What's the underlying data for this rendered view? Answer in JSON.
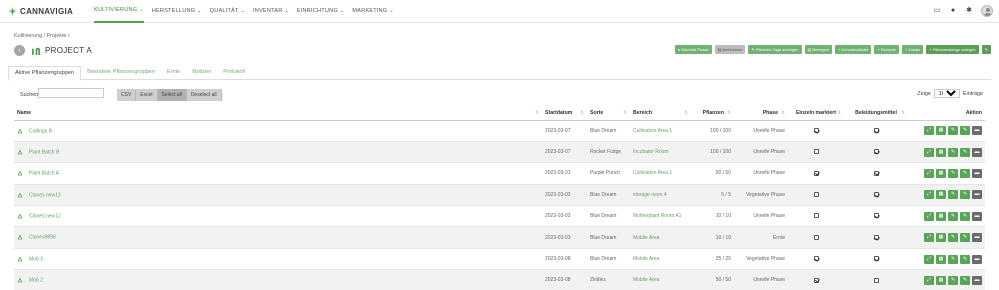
{
  "app": {
    "logo_text": "CANNAVIGIA"
  },
  "nav": [
    {
      "label": "KULTIVIERUNG",
      "active": true,
      "caret": true
    },
    {
      "label": "HERSTELLUNG",
      "active": false,
      "caret": true
    },
    {
      "label": "QUALITÄT",
      "active": false,
      "caret": true
    },
    {
      "label": "INVENTAR",
      "active": false,
      "caret": true
    },
    {
      "label": "EINRICHTUNG",
      "active": false,
      "caret": true
    },
    {
      "label": "MARKETING",
      "active": false,
      "caret": true
    }
  ],
  "breadcrumb": "Kultivierung / Projekte /",
  "title": "PROJECT A",
  "actions": [
    {
      "label": "▸ Nächste Phase",
      "style": "green"
    },
    {
      "label": "▤ Archivieren",
      "style": "gray"
    },
    {
      "label": "✎ Pflanzen-Tags anzeigen",
      "style": "green"
    },
    {
      "label": "▤ Bewegen",
      "style": "green"
    },
    {
      "label": "+ Kreuzbestäube",
      "style": "green"
    },
    {
      "label": "+ Rezepte",
      "style": "green"
    },
    {
      "label": "+ Zusatz",
      "style": "green"
    },
    {
      "label": "+ Pflanzenstange anlegen",
      "style": "dark"
    }
  ],
  "tabs": [
    {
      "label": "Aktive Pflanzengruppen",
      "active": true
    },
    {
      "label": "Beendete Pflanzengruppen",
      "active": false
    },
    {
      "label": "Ernte",
      "active": false
    },
    {
      "label": "Notizen",
      "active": false
    },
    {
      "label": "Protokoll",
      "active": false
    }
  ],
  "controls": {
    "search_label": "Suchen:",
    "search_value": "",
    "buttons": [
      "CSV",
      "Excel",
      "Select all",
      "Deselect all"
    ],
    "show_label": "Zeige",
    "show_value": "10",
    "entries_label": "Einträge"
  },
  "columns": [
    "Name",
    "Startdatum",
    "Sorte",
    "Bereich",
    "Pflanzen",
    "Phase",
    "Einzeln markiert",
    "Beleidungsmittel",
    "Aktion"
  ],
  "rows": [
    {
      "name": "Cuttings B",
      "date": "2023-03-07",
      "strain": "Blue Dream",
      "area": "Cultivation Area 1",
      "plants": "100 / 100",
      "phase": "Unreife Phase",
      "marked": true,
      "means": true
    },
    {
      "name": "Plant Batch B",
      "date": "2023-03-07",
      "strain": "Rocket Fudge",
      "area": "Incubator Room",
      "plants": "100 / 100",
      "phase": "Unreife Phase",
      "marked": false,
      "means": true
    },
    {
      "name": "Plant Batch A",
      "date": "2023-03-31",
      "strain": "Purple Punch",
      "area": "Cultivation Area 1",
      "plants": "50 / 50",
      "phase": "Unreife Phase",
      "marked": true,
      "means": true
    },
    {
      "name": "Clones new13",
      "date": "2023-03-03",
      "strain": "Blue Dream",
      "area": "storage room 4",
      "plants": "5 / 5",
      "phase": "Vegetative Phase",
      "marked": false,
      "means": true
    },
    {
      "name": "Clones new12",
      "date": "2023-03-03",
      "strain": "Blue Dream",
      "area": "Motherplant Room A1",
      "plants": "10 / 10",
      "phase": "Unreife Phase",
      "marked": false,
      "means": true
    },
    {
      "name": "Clones9898",
      "date": "2023-03-03",
      "strain": "Blue Dream",
      "area": "Mobile Area",
      "plants": "10 / 10",
      "phase": "Ernte",
      "marked": false,
      "means": true
    },
    {
      "name": "Mob 3",
      "date": "2023-03-08",
      "strain": "Blue Dream",
      "area": "Mobile Area",
      "plants": "25 / 25",
      "phase": "Vegetative Phase",
      "marked": true,
      "means": true
    },
    {
      "name": "Mob 2",
      "date": "2023-03-08",
      "strain": "Zkittlez",
      "area": "Mobile Area",
      "plants": "50 / 50",
      "phase": "Unreife Phase",
      "marked": true,
      "means": false
    }
  ],
  "colors": {
    "brand_green": "#5a9e5a",
    "link_green": "#6a9e6a",
    "delete_gray": "#6b6b6b"
  }
}
